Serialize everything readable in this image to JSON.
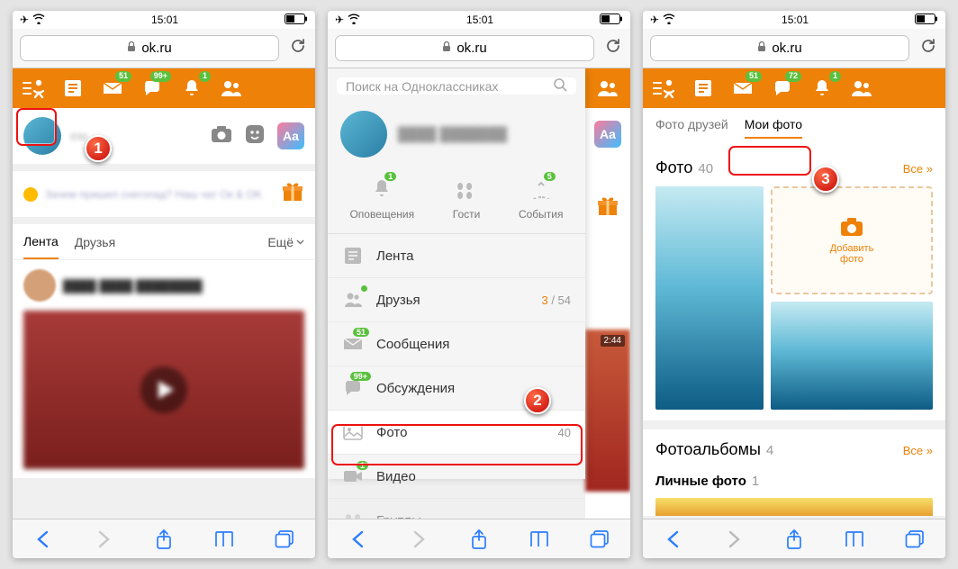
{
  "status": {
    "time": "15:01"
  },
  "browser": {
    "url": "ok.ru"
  },
  "badges": {
    "msg": "51",
    "talk": "99+",
    "bell": "1",
    "msg3": "51",
    "talk3": "72",
    "bell3": "1"
  },
  "p1": {
    "composer_hint": "ем",
    "gift_line": "Зачем пришел снегопад? Наш\nчат Ок & ОK",
    "tabs": {
      "feed": "Лента",
      "friends": "Друзья",
      "more": "Ещё"
    },
    "aa": "Aa"
  },
  "menu": {
    "search_placeholder": "Поиск на Одноклассниках",
    "triple": {
      "notif": "Оповещения",
      "guests": "Гости",
      "events": "События",
      "notif_badge": "1",
      "events_badge": "5"
    },
    "items": {
      "feed": "Лента",
      "friends": "Друзья",
      "friends_new": "3",
      "friends_total": " / 54",
      "messages": "Сообщения",
      "messages_badge": "51",
      "discuss": "Обсуждения",
      "discuss_badge": "99+",
      "photo": "Фото",
      "photo_cnt": "40",
      "video": "Видео",
      "video_badge": "1",
      "groups": "Группы"
    }
  },
  "p3": {
    "tab_friends": "Фото друзей",
    "tab_mine": "Мои фото",
    "sec_photo": "Фото",
    "sec_photo_cnt": "40",
    "all": "Все »",
    "add_photo": "Добавить\nфото",
    "sec_albums": "Фотоальбомы",
    "sec_albums_cnt": "4",
    "album_personal": "Личные фото",
    "album_personal_cnt": "1"
  },
  "callouts": {
    "c1": "1",
    "c2": "2",
    "c3": "3"
  }
}
